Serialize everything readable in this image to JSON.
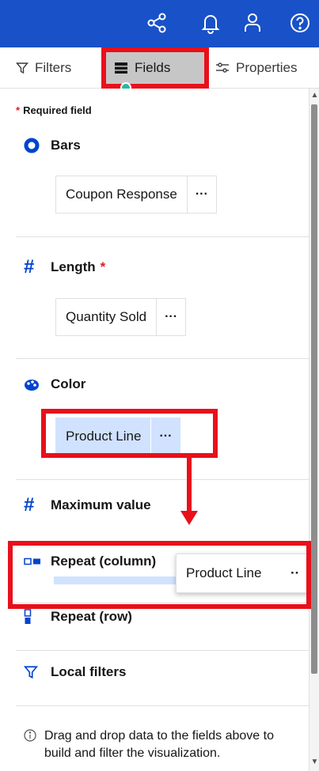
{
  "topbar": {
    "icons": [
      "share-icon",
      "notification-bell-icon",
      "user-icon",
      "help-icon"
    ]
  },
  "tabs": {
    "filters": "Filters",
    "fields": "Fields",
    "properties": "Properties"
  },
  "required_note": "Required field",
  "sections": {
    "bars": {
      "title": "Bars",
      "field": "Coupon Response"
    },
    "length": {
      "title": "Length",
      "field": "Quantity Sold"
    },
    "color": {
      "title": "Color",
      "field": "Product Line"
    },
    "maximum": {
      "title": "Maximum value"
    },
    "repeat_column": {
      "title": "Repeat (column)",
      "dragged_field": "Product Line"
    },
    "repeat_row": {
      "title": "Repeat (row)"
    },
    "local_filters": {
      "title": "Local filters"
    }
  },
  "more_label": "···",
  "more_label_partial": "··",
  "info_text": "Drag and drop data to the fields above to build and filter the visualization.",
  "colors": {
    "brand": "#1951c8",
    "annotation": "#e8101b",
    "selected": "#d0e2ff",
    "required": "#da1e28"
  }
}
